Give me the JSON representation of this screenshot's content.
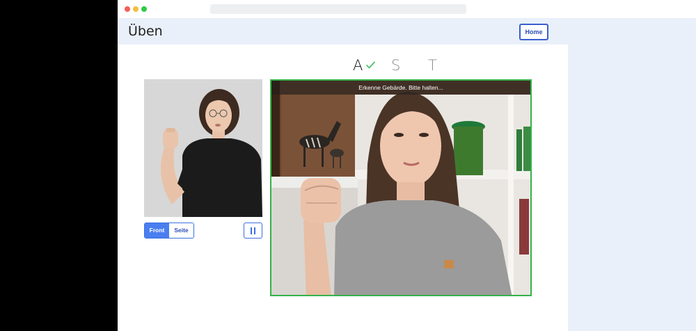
{
  "window": {
    "url": ""
  },
  "header": {
    "title": "Üben",
    "home_label": "Home"
  },
  "letters": [
    {
      "char": "A",
      "status": "done"
    },
    {
      "char": "S",
      "status": "pending"
    },
    {
      "char": "T",
      "status": "pending"
    }
  ],
  "camera": {
    "status_text": "Erkenne Gebärde. Bitte halten...",
    "border_color": "#34b24a"
  },
  "view_toggle": {
    "options": [
      "Front",
      "Seite"
    ],
    "selected": "Front"
  },
  "controls": {
    "pause_icon": "pause-icon"
  },
  "colors": {
    "accent": "#3a6ee0",
    "success": "#34b24a",
    "header_bg": "#e9f0fa"
  }
}
